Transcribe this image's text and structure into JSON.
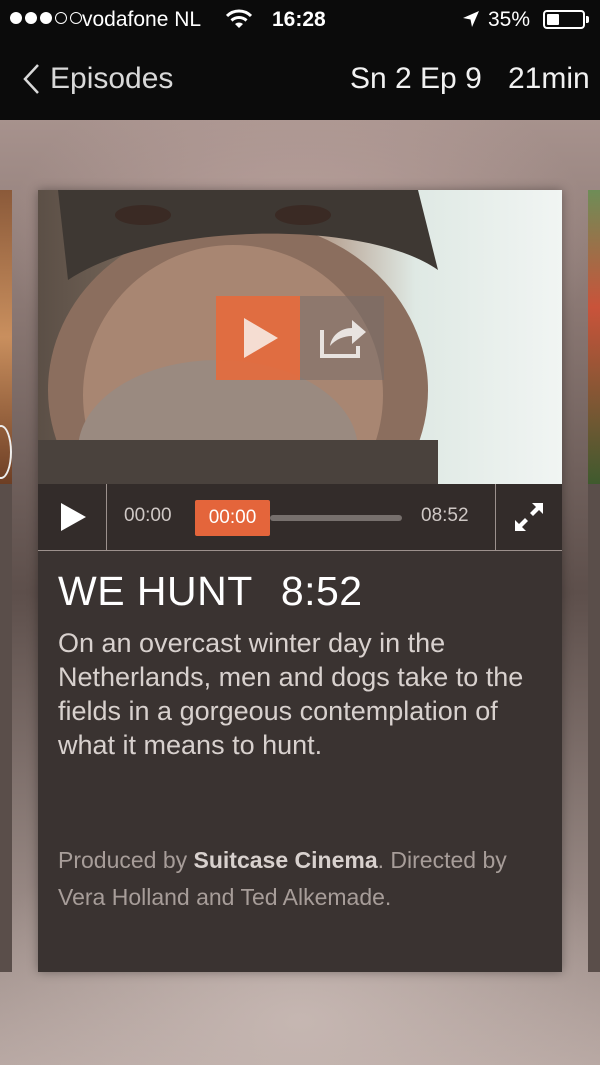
{
  "status_bar": {
    "carrier": "vodafone NL",
    "time": "16:28",
    "battery": "35%",
    "signal_bars_filled": 3,
    "signal_bars_total": 5
  },
  "nav": {
    "back_label": "Episodes",
    "episode": "Sn 2 Ep 9",
    "duration": "21min"
  },
  "player": {
    "current_time": "00:00",
    "scrub_time": "00:00",
    "total_time": "08:52",
    "progress": 0
  },
  "episode": {
    "title": "WE HUNT",
    "length": "8:52",
    "description": "On an overcast winter day in the Netherlands, men and dogs take to the fields in a gorgeous contemplation of what it means to hunt.",
    "credits_prefix": "Produced by ",
    "producer": "Suitcase Cinema",
    "credits_suffix": ". Directed by Vera Holland and Ted Alkemade."
  },
  "colors": {
    "accent": "#e4653b",
    "card_bg": "#3a3331",
    "topbar_bg": "#0b0b0b"
  },
  "icons": [
    "wifi-icon",
    "location-arrow-icon",
    "battery-icon",
    "chevron-left-icon",
    "play-icon",
    "share-icon",
    "fullscreen-icon"
  ]
}
